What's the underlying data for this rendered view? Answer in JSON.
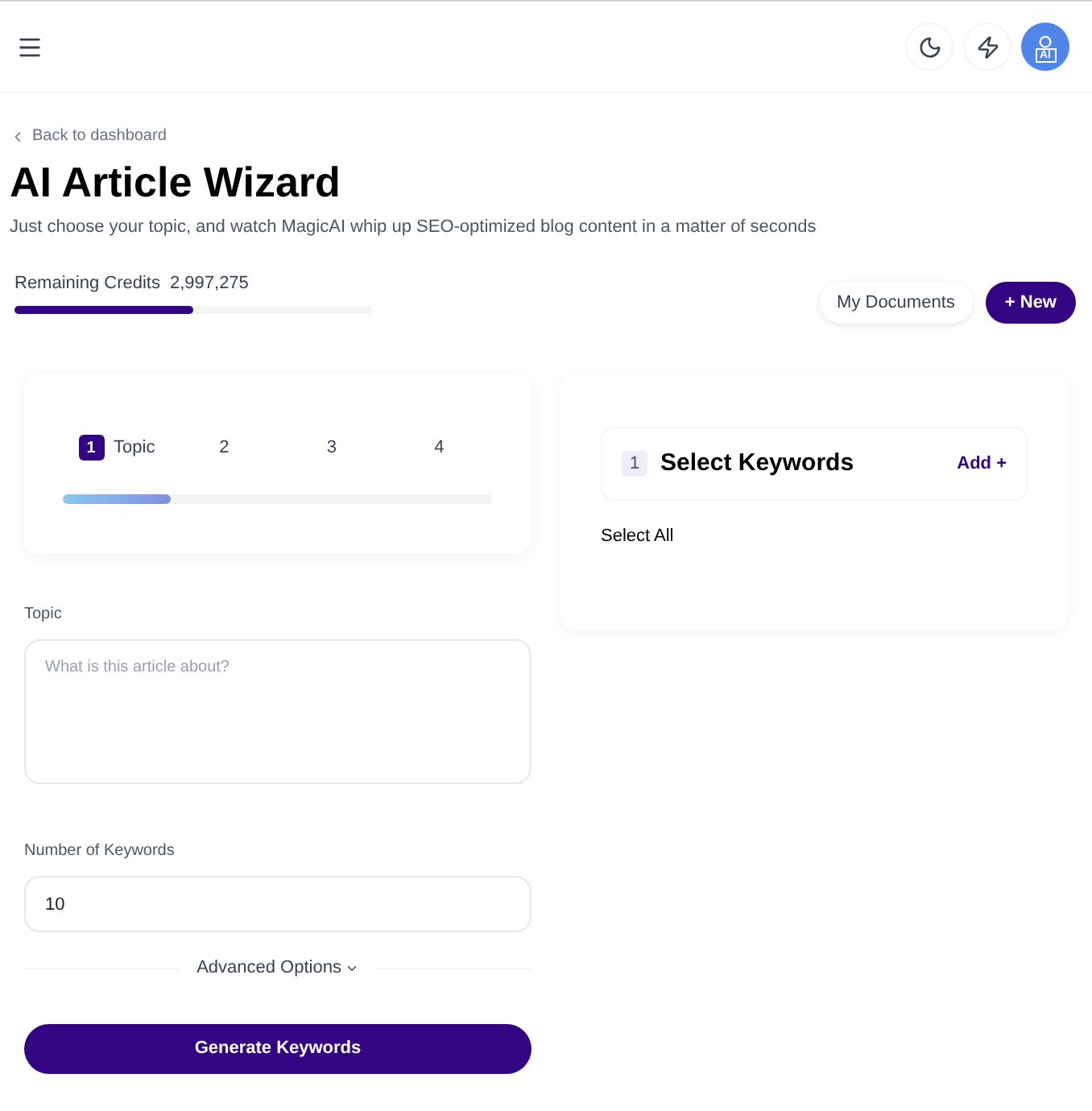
{
  "header": {
    "avatar_label": "AI"
  },
  "back_link": "Back to dashboard",
  "title": "AI Article Wizard",
  "subtitle": "Just choose your topic, and watch MagicAI whip up SEO-optimized blog content in a matter of seconds",
  "credits": {
    "label": "Remaining Credits",
    "value": "2,997,275",
    "level": 0.5
  },
  "actions": [
    "My Documents",
    "+ New"
  ],
  "steps": [
    {
      "number": "1",
      "label": "Topic",
      "selected": true
    },
    {
      "number": "2",
      "selected": false
    },
    {
      "number": "3",
      "selected": false
    },
    {
      "number": "4",
      "selected": false
    }
  ],
  "steps_progress": {
    "level": 0.25
  },
  "keywords_panel": {
    "number": "1",
    "title": "Select Keywords",
    "add": "Add +",
    "select_all": "Select All"
  },
  "form": {
    "topic_label": "Topic",
    "topic_placeholder": "What is this article about?",
    "count_label": "Number of Keywords",
    "count_value": "10",
    "advanced": "Advanced Options",
    "submit": "Generate Keywords"
  }
}
